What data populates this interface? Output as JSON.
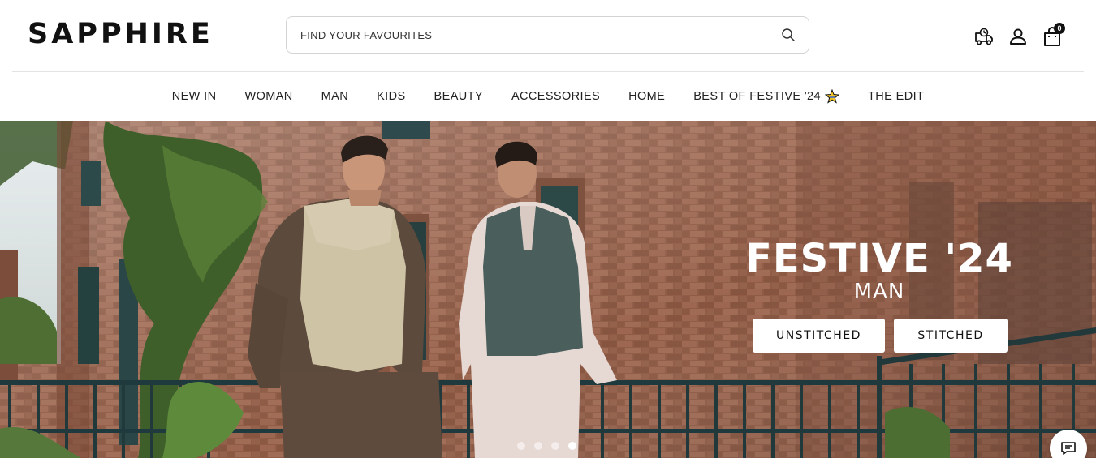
{
  "header": {
    "logo": "SAPPHIRE",
    "search_placeholder": "FIND YOUR FAVOURITES",
    "cart_count": "0"
  },
  "nav": {
    "items": [
      "NEW IN",
      "WOMAN",
      "MAN",
      "KIDS",
      "BEAUTY",
      "ACCESSORIES",
      "HOME",
      "BEST OF FESTIVE '24",
      "THE EDIT"
    ]
  },
  "hero": {
    "title": "FESTIVE '24",
    "subtitle": "MAN",
    "buttons": [
      "UNSTITCHED",
      "STITCHED"
    ],
    "slides_total": 4,
    "active_slide": 4
  },
  "icons": {
    "search": "search-icon",
    "delivery": "delivery-truck-icon",
    "account": "user-icon",
    "cart": "shopping-bag-icon",
    "chat": "chat-icon",
    "festive": "sparkle-star-icon"
  }
}
